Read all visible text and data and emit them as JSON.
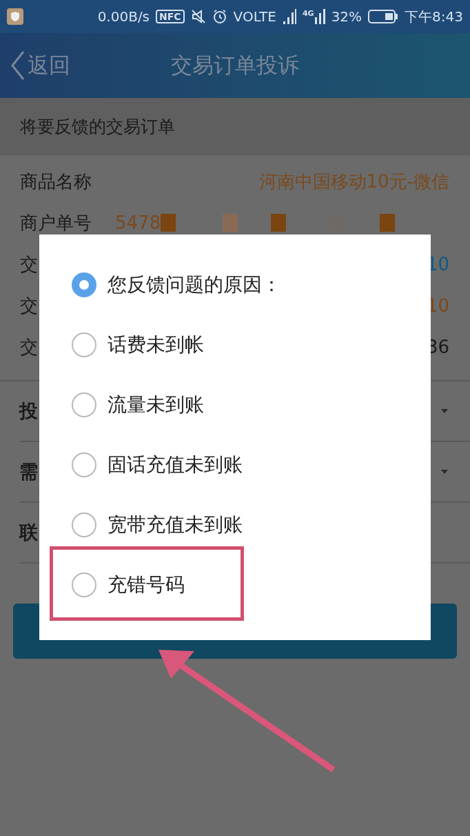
{
  "status_bar": {
    "speed": "0.00B/s",
    "nfc": "NFC",
    "network": "VOLTE",
    "net_type": "4G",
    "battery": "32%",
    "time": "下午8:43"
  },
  "header": {
    "back": "返回",
    "title": "交易订单投诉"
  },
  "section_title": "将要反馈的交易订单",
  "info_rows": [
    {
      "label": "商品名称",
      "value": "河南中国移动10元-微信",
      "kind": "text",
      "color": "#7a4a1e"
    },
    {
      "label": "商户单号",
      "value": "5478",
      "kind": "redacted",
      "color": "#7a4a1e"
    },
    {
      "label": "交",
      "value": "10",
      "kind": "text",
      "color": "#0f5a85"
    },
    {
      "label": "交",
      "value": "10",
      "kind": "text",
      "color": "#7a4a1e"
    },
    {
      "label": "交",
      "value": "36",
      "kind": "text",
      "color": "#1a1a1a"
    }
  ],
  "form_rows": [
    {
      "label": "投",
      "dropdown": true
    },
    {
      "label": "需",
      "dropdown": true
    },
    {
      "label": "联",
      "dropdown": false
    }
  ],
  "dialog": {
    "options": [
      {
        "label": "您反馈问题的原因：",
        "selected": true,
        "highlighted": false
      },
      {
        "label": "话费未到帐",
        "selected": false,
        "highlighted": false
      },
      {
        "label": "流量未到账",
        "selected": false,
        "highlighted": false
      },
      {
        "label": "固话充值未到账",
        "selected": false,
        "highlighted": false
      },
      {
        "label": "宽带充值未到账",
        "selected": false,
        "highlighted": false
      },
      {
        "label": "充错号码",
        "selected": false,
        "highlighted": true
      }
    ]
  }
}
